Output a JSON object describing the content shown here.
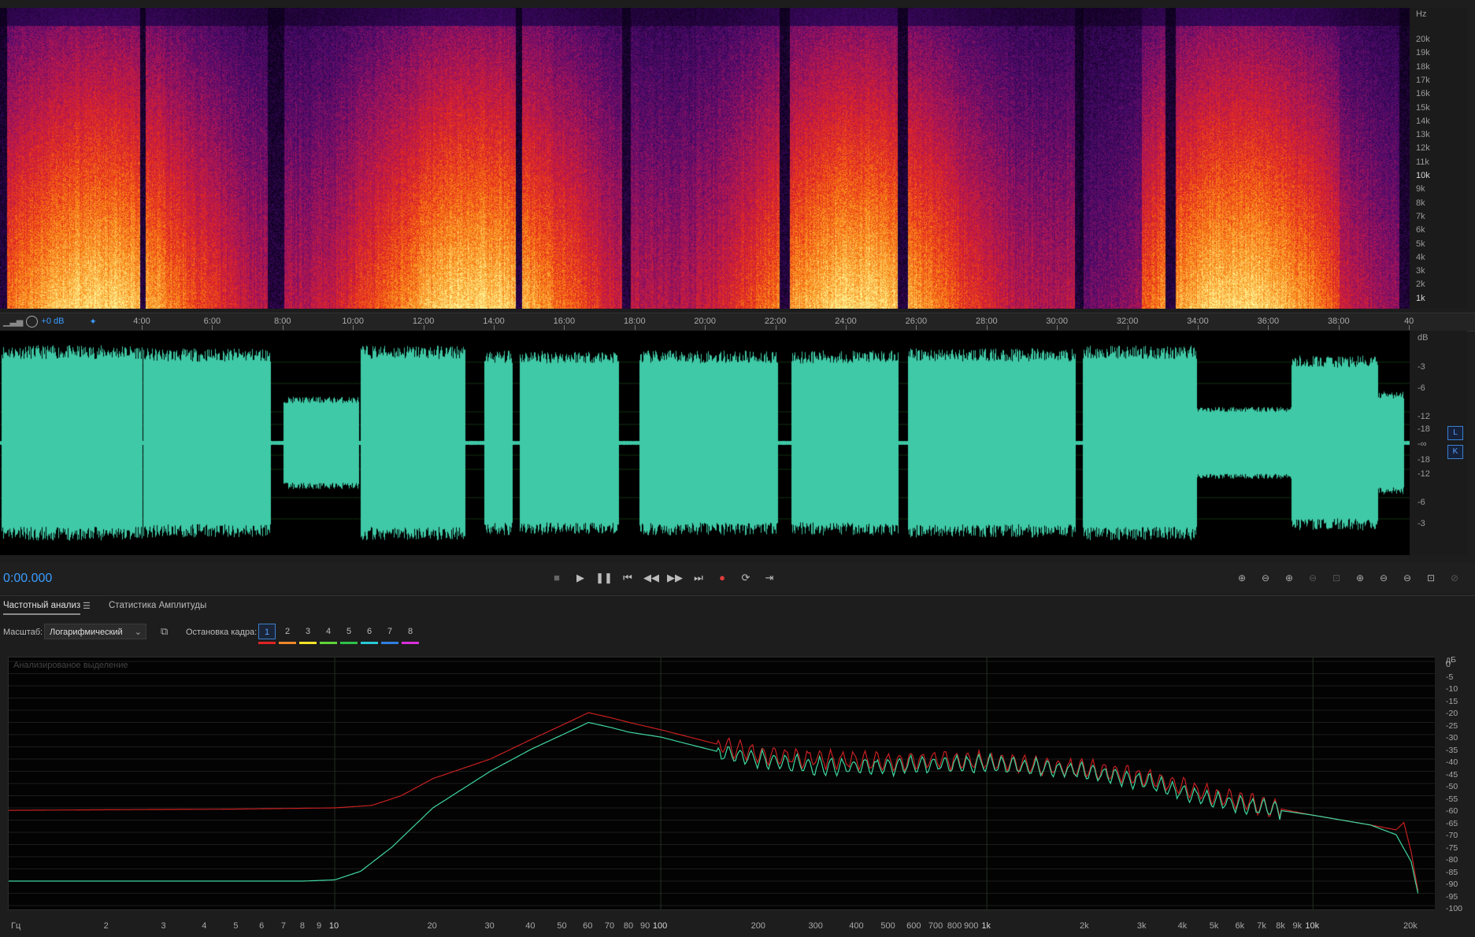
{
  "spectrogram": {
    "unit": "Hz",
    "freq_labels": [
      "20k",
      "19k",
      "18k",
      "17k",
      "16k",
      "15k",
      "14k",
      "13k",
      "12k",
      "11k",
      "10k",
      "9k",
      "8k",
      "7k",
      "6k",
      "5k",
      "4k",
      "3k",
      "2k",
      "1k"
    ]
  },
  "timeline": {
    "gain": "+0 dB",
    "ticks": [
      "4:00",
      "6:00",
      "8:00",
      "10:00",
      "12:00",
      "14:00",
      "16:00",
      "18:00",
      "20:00",
      "22:00",
      "24:00",
      "26:00",
      "28:00",
      "30:00",
      "32:00",
      "34:00",
      "36:00",
      "38:00",
      "40"
    ]
  },
  "waveform": {
    "unit": "dB",
    "db_labels_top": [
      "-3",
      "-6",
      "-12",
      "-18"
    ],
    "center_label": "-∞",
    "db_labels_bottom": [
      "-18",
      "-12",
      "-6",
      "-3"
    ],
    "channels": [
      "L",
      "K"
    ],
    "color": "#3fc9a6"
  },
  "transport": {
    "time": "0:00.000",
    "buttons": [
      "stop-icon",
      "play-icon",
      "pause-icon",
      "go-to-start-icon",
      "rewind-icon",
      "fast-forward-icon",
      "go-to-end-icon",
      "record-icon",
      "loop-icon",
      "skip-icon"
    ],
    "zoom_buttons": [
      "zoom-in-amplitude-icon",
      "zoom-out-amplitude-icon",
      "zoom-in-time-icon",
      "zoom-out-time-icon",
      "zoom-selection-icon",
      "zoom-in-left-icon",
      "zoom-in-right-icon",
      "zoom-out-full-icon",
      "zoom-fit-icon",
      "zoom-reset-icon"
    ]
  },
  "panel": {
    "tabs": [
      "Частотный анализ",
      "Статистика Амплитуды"
    ],
    "scale_label": "Масштаб:",
    "scale_value": "Логарифмический",
    "freeze_label": "Остановка кадра:",
    "frames": [
      "1",
      "2",
      "3",
      "4",
      "5",
      "6",
      "7",
      "8"
    ],
    "frame_colors": [
      "#e02424",
      "#f0862a",
      "#f2e22a",
      "#5fd63a",
      "#2ec24a",
      "#29c9d6",
      "#2f7fe0",
      "#d82fd8"
    ],
    "caption": "Анализированое выделение"
  },
  "freq_plot": {
    "db_unit": "дБ",
    "db_labels": [
      "0",
      "-5",
      "-10",
      "-15",
      "-20",
      "-25",
      "-30",
      "-35",
      "-40",
      "-45",
      "-50",
      "-55",
      "-60",
      "-65",
      "-70",
      "-75",
      "-80",
      "-85",
      "-90",
      "-95",
      "-100"
    ],
    "hz_unit": "Гц",
    "hz_labels": [
      {
        "v": 2,
        "t": "2"
      },
      {
        "v": 3,
        "t": "3"
      },
      {
        "v": 4,
        "t": "4"
      },
      {
        "v": 5,
        "t": "5"
      },
      {
        "v": 6,
        "t": "6"
      },
      {
        "v": 7,
        "t": "7"
      },
      {
        "v": 8,
        "t": "8"
      },
      {
        "v": 9,
        "t": "9"
      },
      {
        "v": 10,
        "t": "10",
        "major": true
      },
      {
        "v": 20,
        "t": "20"
      },
      {
        "v": 30,
        "t": "30"
      },
      {
        "v": 40,
        "t": "40"
      },
      {
        "v": 50,
        "t": "50"
      },
      {
        "v": 60,
        "t": "60"
      },
      {
        "v": 70,
        "t": "70"
      },
      {
        "v": 80,
        "t": "80"
      },
      {
        "v": 90,
        "t": "90"
      },
      {
        "v": 100,
        "t": "100",
        "major": true
      },
      {
        "v": 200,
        "t": "200"
      },
      {
        "v": 300,
        "t": "300"
      },
      {
        "v": 400,
        "t": "400"
      },
      {
        "v": 500,
        "t": "500"
      },
      {
        "v": 600,
        "t": "600"
      },
      {
        "v": 700,
        "t": "700"
      },
      {
        "v": 800,
        "t": "800"
      },
      {
        "v": 900,
        "t": "900"
      },
      {
        "v": 1000,
        "t": "1k",
        "major": true
      },
      {
        "v": 2000,
        "t": "2k"
      },
      {
        "v": 3000,
        "t": "3k"
      },
      {
        "v": 4000,
        "t": "4k"
      },
      {
        "v": 5000,
        "t": "5k"
      },
      {
        "v": 6000,
        "t": "6k"
      },
      {
        "v": 7000,
        "t": "7k"
      },
      {
        "v": 8000,
        "t": "8k"
      },
      {
        "v": 9000,
        "t": "9k"
      },
      {
        "v": 10000,
        "t": "10k",
        "major": true
      },
      {
        "v": 20000,
        "t": "20k"
      }
    ],
    "red_series": [
      [
        1,
        -61
      ],
      [
        5,
        -60.5
      ],
      [
        10,
        -60
      ],
      [
        13,
        -59
      ],
      [
        16,
        -55
      ],
      [
        20,
        -48
      ],
      [
        30,
        -40
      ],
      [
        40,
        -32
      ],
      [
        50,
        -26
      ],
      [
        60,
        -21
      ],
      [
        70,
        -23
      ],
      [
        80,
        -25
      ],
      [
        100,
        -28
      ],
      [
        150,
        -34
      ],
      [
        200,
        -38
      ],
      [
        300,
        -40
      ],
      [
        500,
        -41
      ],
      [
        700,
        -40
      ],
      [
        1000,
        -41
      ],
      [
        2000,
        -44
      ],
      [
        3000,
        -47
      ],
      [
        5000,
        -55
      ],
      [
        7000,
        -59
      ],
      [
        10000,
        -63
      ],
      [
        15000,
        -67
      ],
      [
        18000,
        -69
      ],
      [
        19000,
        -66
      ],
      [
        20000,
        -78
      ],
      [
        21000,
        -94
      ]
    ],
    "green_series": [
      [
        1,
        -90
      ],
      [
        5,
        -90
      ],
      [
        8,
        -90
      ],
      [
        10,
        -89.5
      ],
      [
        12,
        -86
      ],
      [
        15,
        -76
      ],
      [
        20,
        -60
      ],
      [
        30,
        -45
      ],
      [
        40,
        -36
      ],
      [
        50,
        -30
      ],
      [
        60,
        -25
      ],
      [
        70,
        -27
      ],
      [
        80,
        -29
      ],
      [
        100,
        -31
      ],
      [
        150,
        -37
      ],
      [
        200,
        -40
      ],
      [
        300,
        -43
      ],
      [
        500,
        -43
      ],
      [
        700,
        -42
      ],
      [
        1000,
        -42
      ],
      [
        2000,
        -45
      ],
      [
        3000,
        -49
      ],
      [
        5000,
        -57
      ],
      [
        7000,
        -60
      ],
      [
        10000,
        -63
      ],
      [
        15000,
        -67
      ],
      [
        18000,
        -71
      ],
      [
        20000,
        -82
      ],
      [
        21000,
        -95
      ]
    ]
  }
}
